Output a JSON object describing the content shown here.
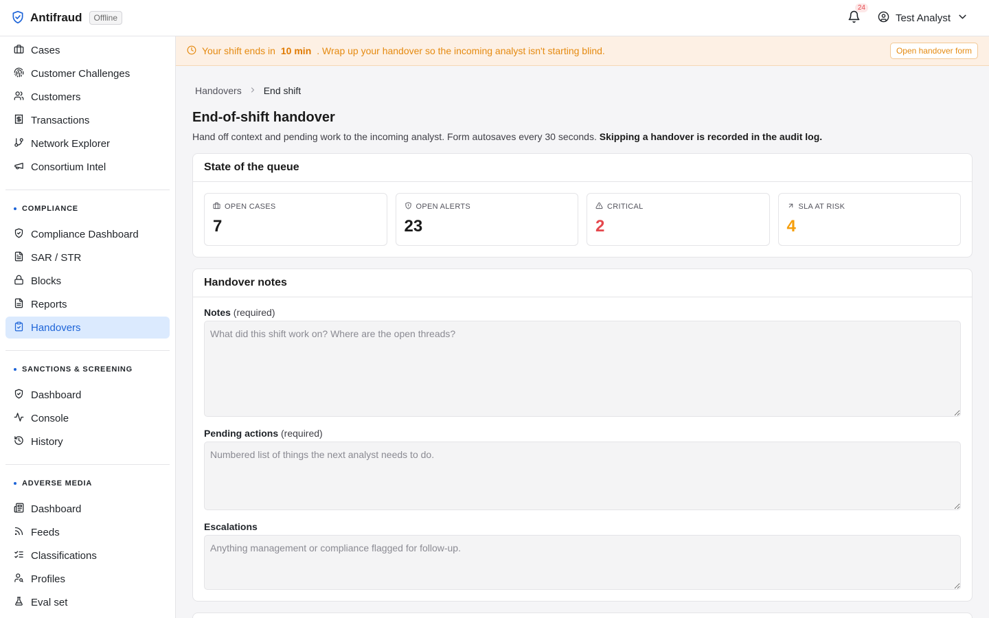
{
  "app": {
    "name": "Antifraud",
    "status_badge": "Offline",
    "notification_count": "24",
    "user_name": "Test Analyst"
  },
  "sidebar": {
    "main_items": [
      {
        "label": "Cases",
        "icon": "briefcase-icon"
      },
      {
        "label": "Customer Challenges",
        "icon": "fingerprint-icon"
      },
      {
        "label": "Customers",
        "icon": "users-icon"
      },
      {
        "label": "Transactions",
        "icon": "receipt-icon"
      },
      {
        "label": "Network Explorer",
        "icon": "git-branch-icon"
      },
      {
        "label": "Consortium Intel",
        "icon": "megaphone-icon"
      }
    ],
    "compliance": {
      "title": "COMPLIANCE",
      "items": [
        {
          "label": "Compliance Dashboard",
          "icon": "shield-check-icon"
        },
        {
          "label": "SAR / STR",
          "icon": "file-text-icon"
        },
        {
          "label": "Blocks",
          "icon": "lock-icon"
        },
        {
          "label": "Reports",
          "icon": "file-lines-icon"
        },
        {
          "label": "Handovers",
          "icon": "clipboard-check-icon",
          "active": true
        }
      ]
    },
    "sanctions": {
      "title": "SANCTIONS & SCREENING",
      "items": [
        {
          "label": "Dashboard",
          "icon": "shield-check-icon"
        },
        {
          "label": "Console",
          "icon": "activity-icon"
        },
        {
          "label": "History",
          "icon": "history-icon"
        }
      ]
    },
    "adverse_media": {
      "title": "ADVERSE MEDIA",
      "items": [
        {
          "label": "Dashboard",
          "icon": "newspaper-icon"
        },
        {
          "label": "Feeds",
          "icon": "rss-icon"
        },
        {
          "label": "Classifications",
          "icon": "list-checks-icon"
        },
        {
          "label": "Profiles",
          "icon": "user-search-icon"
        },
        {
          "label": "Eval set",
          "icon": "flask-icon"
        }
      ]
    }
  },
  "banner": {
    "text_before": "Your shift ends in",
    "time": "10 min",
    "text_after": ". Wrap up your handover so the incoming analyst isn't starting blind.",
    "button_label": "Open handover form"
  },
  "breadcrumb": {
    "parent": "Handovers",
    "current": "End shift"
  },
  "page": {
    "title": "End-of-shift handover",
    "description": "Hand off context and pending work to the incoming analyst. Form autosaves every 30 seconds.",
    "description_bold": "Skipping a handover is recorded in the audit log."
  },
  "queue": {
    "title": "State of the queue",
    "stats": [
      {
        "label": "OPEN CASES",
        "value": "7",
        "icon": "briefcase-icon"
      },
      {
        "label": "OPEN ALERTS",
        "value": "23",
        "icon": "shield-alert-icon"
      },
      {
        "label": "CRITICAL",
        "value": "2",
        "icon": "triangle-alert-icon",
        "color": "#e5484d"
      },
      {
        "label": "SLA AT RISK",
        "value": "4",
        "icon": "arrow-up-right-icon",
        "color": "#f59e0b"
      }
    ]
  },
  "notes": {
    "title": "Handover notes",
    "notes_label": "Notes",
    "notes_req": "(required)",
    "notes_placeholder": "What did this shift work on? Where are the open threads?",
    "pending_label": "Pending actions",
    "pending_req": "(required)",
    "pending_placeholder": "Numbered list of things the next analyst needs to do.",
    "escalations_label": "Escalations",
    "escalations_placeholder": "Anything management or compliance flagged for follow-up."
  },
  "colors": {
    "accent": "#1d64d8",
    "warning": "#e58a10",
    "critical": "#e5484d",
    "sla": "#f59e0b"
  }
}
